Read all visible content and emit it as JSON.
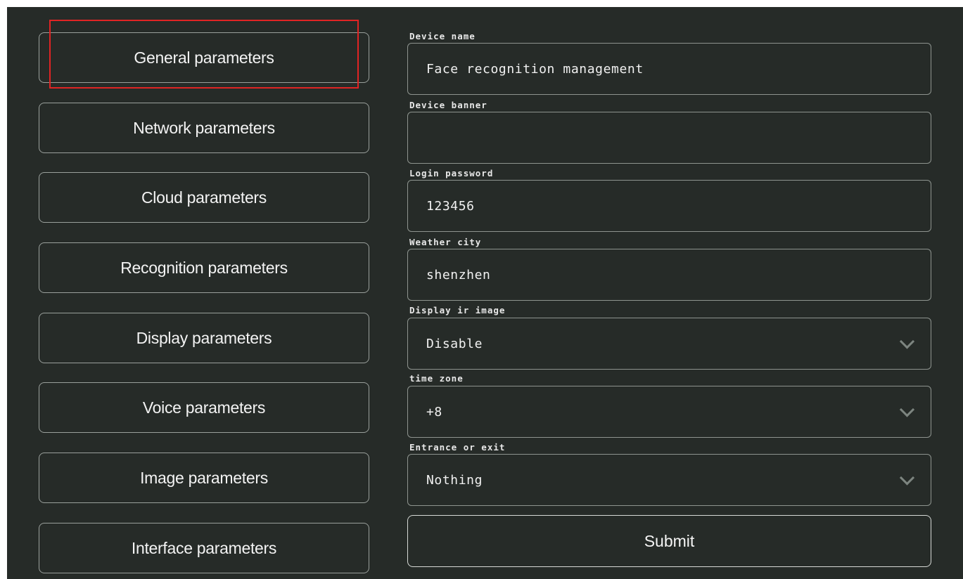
{
  "sidebar": {
    "items": [
      {
        "label": "General parameters"
      },
      {
        "label": "Network parameters"
      },
      {
        "label": "Cloud parameters"
      },
      {
        "label": "Recognition parameters"
      },
      {
        "label": "Display parameters"
      },
      {
        "label": "Voice parameters"
      },
      {
        "label": "Image parameters"
      },
      {
        "label": "Interface parameters"
      }
    ],
    "selected_index": 0,
    "highlight_color": "#e02424"
  },
  "form": {
    "fields": [
      {
        "label": "Device name",
        "value": "Face recognition management",
        "type": "text"
      },
      {
        "label": "Device banner",
        "value": "",
        "type": "text"
      },
      {
        "label": "Login password",
        "value": "123456",
        "type": "text"
      },
      {
        "label": "Weather city",
        "value": "shenzhen",
        "type": "text"
      },
      {
        "label": "Display ir image",
        "value": "Disable",
        "type": "select",
        "icon": "chevron-down-icon"
      },
      {
        "label": "time zone",
        "value": "+8",
        "type": "select",
        "icon": "chevron-down-icon"
      },
      {
        "label": "Entrance or exit",
        "value": "Nothing",
        "type": "select",
        "icon": "chevron-down-icon"
      }
    ],
    "submit_label": "Submit"
  },
  "colors": {
    "background": "#262b28",
    "border": "#9aa09c",
    "text": "#f3f3f3"
  }
}
